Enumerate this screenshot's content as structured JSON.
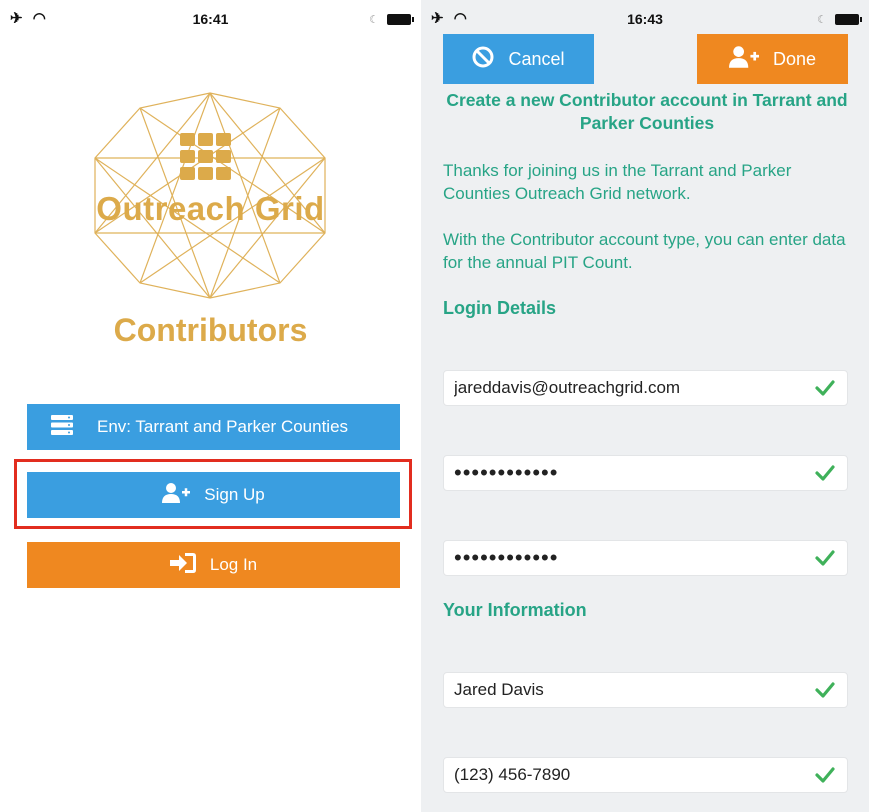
{
  "left": {
    "status": {
      "time": "16:41"
    },
    "logo_text": "Outreach Grid",
    "subtitle": "Contributors",
    "env_button": {
      "label": "Env: Tarrant and Parker Counties",
      "icon": "server-icon"
    },
    "signup_button": {
      "label": "Sign Up",
      "icon": "user-plus-icon"
    },
    "login_button": {
      "label": "Log In",
      "icon": "sign-in-icon"
    }
  },
  "right": {
    "status": {
      "time": "16:43"
    },
    "cancel_button": {
      "label": "Cancel",
      "icon": "ban-icon"
    },
    "done_button": {
      "label": "Done",
      "icon": "user-plus-icon"
    },
    "heading": "Create a new Contributor account in Tarrant and Parker Counties",
    "paragraph1": "Thanks for joining us in the Tarrant and Parker Counties Outreach Grid network.",
    "paragraph2": "With the Contributor account type, you can enter data for the annual PIT Count.",
    "login_details_label": "Login Details",
    "email_value": "jareddavis@outreachgrid.com",
    "password_value": "••••••••••••",
    "confirm_password_value": "••••••••••••",
    "your_information_label": "Your Information",
    "name_value": "Jared Davis",
    "phone_value": "(123) 456-7890"
  },
  "colors": {
    "blue": "#3a9ee0",
    "orange": "#ef8820",
    "gold": "#dcaa4a",
    "green": "#27a486",
    "highlight_red": "#e22d1f"
  }
}
